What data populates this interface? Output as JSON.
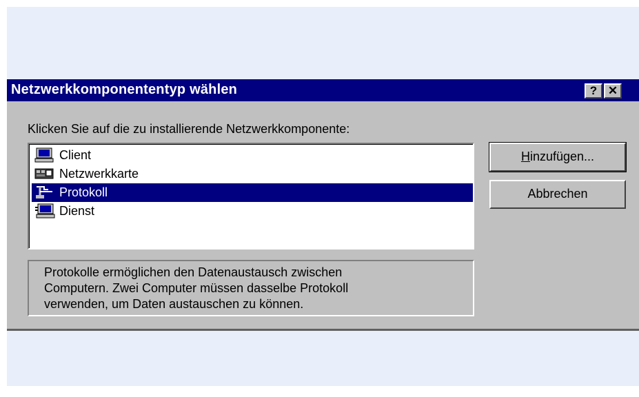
{
  "dialog": {
    "title": "Netzwerkkomponententyp wählen",
    "help_glyph": "?",
    "close_glyph": "✕",
    "instruction": "Klicken Sie auf die zu installierende Netzwerkkomponente:",
    "list_items": [
      {
        "label": "Client",
        "icon": "client-computer-icon",
        "selected": false
      },
      {
        "label": "Netzwerkkarte",
        "icon": "network-card-icon",
        "selected": false
      },
      {
        "label": "Protokoll",
        "icon": "protocol-icon",
        "selected": true
      },
      {
        "label": "Dienst",
        "icon": "service-icon",
        "selected": false
      }
    ],
    "description_lines": [
      "Protokolle ermöglichen den Datenaustausch zwischen",
      "Computern. Zwei Computer müssen dasselbe Protokoll",
      "verwenden, um Daten austauschen zu können."
    ],
    "buttons": {
      "add_mnemonic": "H",
      "add_rest": "inzufügen...",
      "cancel": "Abbrechen"
    }
  },
  "colors": {
    "titlebar": "#000080",
    "dialog_face": "#c0c0c0",
    "selection": "#000080",
    "background": "#e8eefa"
  }
}
